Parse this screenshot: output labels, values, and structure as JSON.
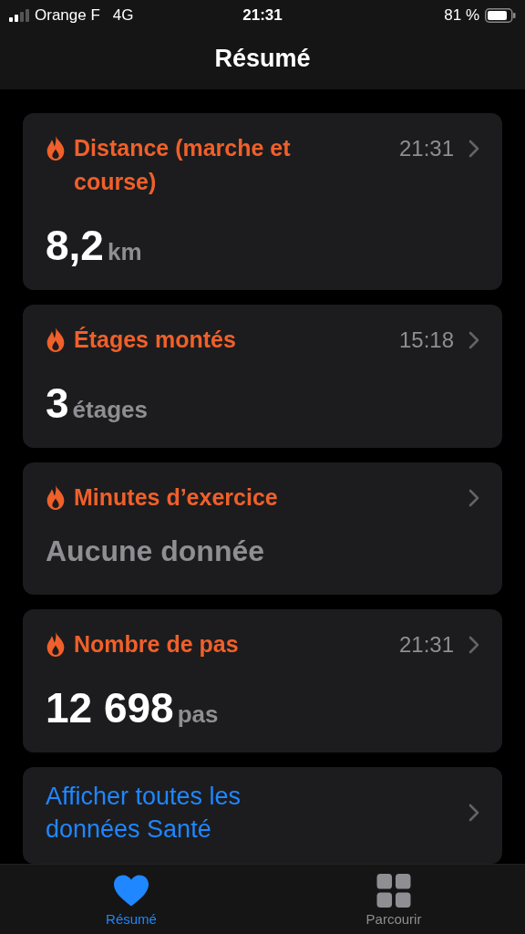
{
  "status_bar": {
    "carrier": "Orange F",
    "network": "4G",
    "time": "21:31",
    "battery": "81 %"
  },
  "nav_title": "Résumé",
  "cards": [
    {
      "kind": "metric",
      "title": "Distance (marche et course)",
      "time": "21:31",
      "value": "8,2",
      "unit": "km"
    },
    {
      "kind": "metric",
      "title": "Étages montés",
      "time": "15:18",
      "value": "3",
      "unit": "étages"
    },
    {
      "kind": "empty",
      "title": "Minutes d’exercice",
      "text": "Aucune donnée"
    },
    {
      "kind": "metric",
      "title": "Nombre de pas",
      "time": "21:31",
      "value": "12 698",
      "unit": "pas"
    },
    {
      "kind": "link",
      "text": "Afficher toutes les données Santé"
    }
  ],
  "tabs": [
    {
      "kind": "heart",
      "label": "Résumé",
      "selected": true
    },
    {
      "kind": "grid",
      "label": "Parcourir",
      "selected": false
    }
  ]
}
